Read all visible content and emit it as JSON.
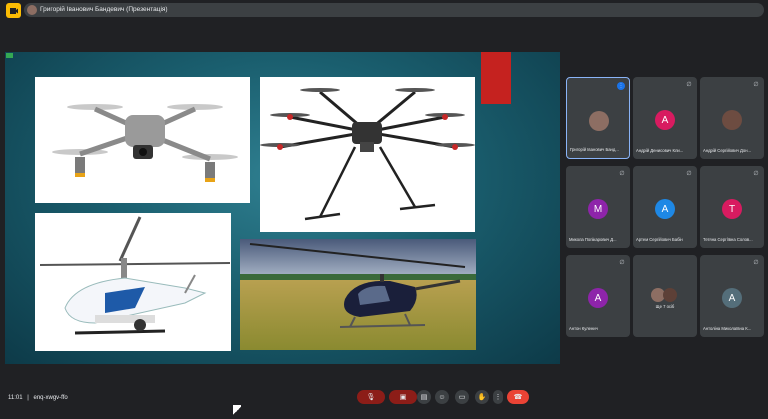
{
  "app": {
    "icon": "meet-app-icon",
    "accent": "#fbbc04"
  },
  "presentation_bar": {
    "text": "Григорій Іванович Бандевич (Презентація)"
  },
  "slide": {
    "images": [
      {
        "icon": "quadcopter-drone-image"
      },
      {
        "icon": "hexacopter-drone-image"
      },
      {
        "icon": "unmanned-helicopter-image"
      },
      {
        "icon": "light-helicopter-image"
      }
    ],
    "accent_color": "#c5221f"
  },
  "participants": [
    {
      "name": "Григорій Іванович Банд...",
      "initial": "",
      "avatar_color": "#8d6e63",
      "status": "speaking"
    },
    {
      "name": "Андрій Денисович Кли...",
      "initial": "A",
      "avatar_color": "#d81b60",
      "status": "muted"
    },
    {
      "name": "Андрій Сергійович Дон...",
      "initial": "",
      "avatar_color": "#6d4c41",
      "status": "muted"
    },
    {
      "name": "Микола Попікарович Д...",
      "initial": "M",
      "avatar_color": "#8e24aa",
      "status": "muted"
    },
    {
      "name": "Артем Сергійович Бабін",
      "initial": "A",
      "avatar_color": "#1e88e5",
      "status": "muted"
    },
    {
      "name": "Тетяна Сергіївна Солов...",
      "initial": "T",
      "avatar_color": "#d81b60",
      "status": "muted"
    },
    {
      "name": "Антон Куленич",
      "initial": "A",
      "avatar_color": "#8e24aa",
      "status": "muted"
    },
    {
      "name": "Ще 7 осіб",
      "initial": "",
      "avatar_color": "#5f6368",
      "status": ""
    },
    {
      "name": "Антоліна Миколаївна К...",
      "initial": "A",
      "avatar_color": "#546e7a",
      "status": "muted"
    }
  ],
  "bottom": {
    "time": "11:01",
    "meeting_code": "enq-xwgv-ffo",
    "controls": [
      {
        "name": "mic-button",
        "glyph": "🎤"
      },
      {
        "name": "camera-button",
        "glyph": "▢"
      },
      {
        "name": "captions-button",
        "glyph": "▤"
      },
      {
        "name": "emoji-button",
        "glyph": "☺"
      },
      {
        "name": "present-button",
        "glyph": "▭"
      },
      {
        "name": "raise-hand-button",
        "glyph": "✋"
      },
      {
        "name": "more-options-button",
        "glyph": "⋮"
      },
      {
        "name": "leave-call-button",
        "glyph": "☎"
      }
    ]
  }
}
